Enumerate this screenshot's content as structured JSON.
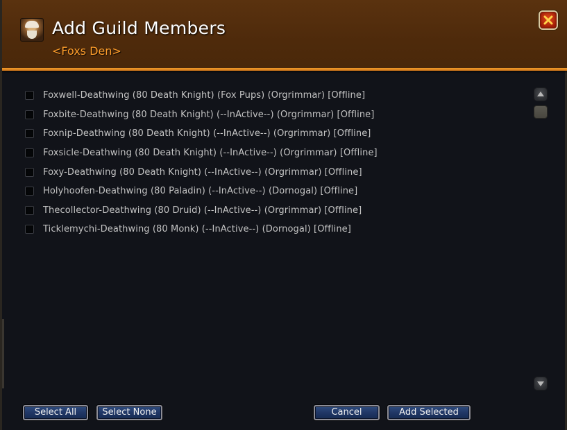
{
  "dialog": {
    "title": "Add Guild Members",
    "subtitle": "<Foxs Den>",
    "portrait_icon": "character-portrait-icon",
    "close_icon": "close-x-icon",
    "colors": {
      "header": "#52300d",
      "accent_rule": "#f09a2a",
      "subtitle": "#ff9e2b",
      "background": "#111319",
      "button": "#1f3563"
    }
  },
  "members": [
    {
      "label": "Foxwell-Deathwing (80 Death Knight) (Fox Pups) (Orgrimmar) [Offline]",
      "checked": false
    },
    {
      "label": "Foxbite-Deathwing (80 Death Knight) (--InActive--) (Orgrimmar) [Offline]",
      "checked": false
    },
    {
      "label": "Foxnip-Deathwing (80 Death Knight) (--InActive--) (Orgrimmar) [Offline]",
      "checked": false
    },
    {
      "label": "Foxsicle-Deathwing (80 Death Knight) (--InActive--) (Orgrimmar) [Offline]",
      "checked": false
    },
    {
      "label": "Foxy-Deathwing (80 Death Knight) (--InActive--) (Orgrimmar) [Offline]",
      "checked": false
    },
    {
      "label": "Holyhoofen-Deathwing (80 Paladin) (--InActive--) (Dornogal) [Offline]",
      "checked": false
    },
    {
      "label": "Thecollector-Deathwing (80 Druid) (--InActive--) (Orgrimmar) [Offline]",
      "checked": false
    },
    {
      "label": "Ticklemychi-Deathwing (80 Monk) (--InActive--) (Dornogal) [Offline]",
      "checked": false
    }
  ],
  "scrollbar": {
    "up_icon": "scroll-up-arrow-icon",
    "down_icon": "scroll-down-arrow-icon"
  },
  "buttons": {
    "select_all": "Select All",
    "select_none": "Select None",
    "cancel": "Cancel",
    "add_selected": "Add Selected"
  }
}
